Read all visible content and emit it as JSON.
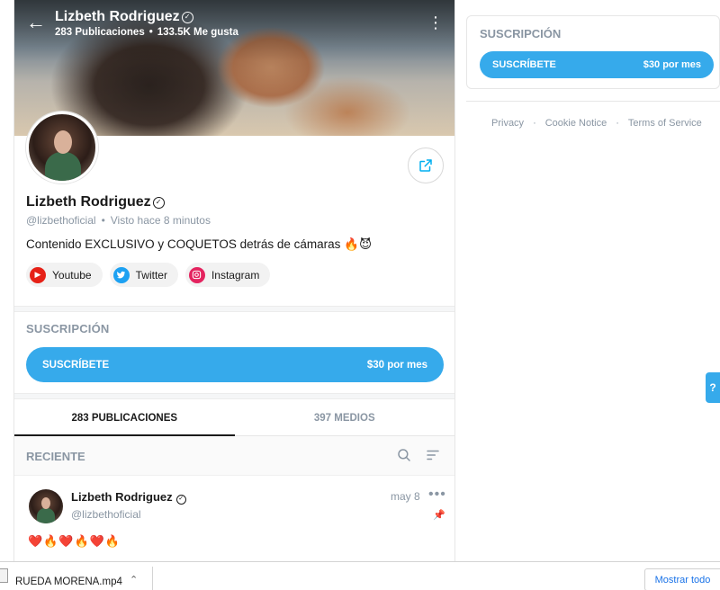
{
  "profile": {
    "name": "Lizbeth Rodriguez",
    "verified_mark": "✓",
    "posts_count": "283 Publicaciones",
    "likes_count": "133.5K Me gusta",
    "handle": "@lizbethoficial",
    "seen": "Visto  hace 8 minutos",
    "bio": "Contenido EXCLUSIVO y COQUETOS detrás de cámaras 🔥😈",
    "socials": [
      {
        "label": "Youtube",
        "icon": "youtube-icon",
        "color": "#e62117"
      },
      {
        "label": "Twitter",
        "icon": "twitter-icon",
        "color": "#1da1f2"
      },
      {
        "label": "Instagram",
        "icon": "instagram-icon",
        "color": "#e4235f"
      }
    ]
  },
  "subscription": {
    "title": "SUSCRIPCIÓN",
    "button_label": "SUSCRÍBETE",
    "price": "$30 por mes",
    "accent": "#36aaeb"
  },
  "tabs": [
    {
      "label": "283 PUBLICACIONES",
      "active": true
    },
    {
      "label": "397 MEDIOS",
      "active": false
    }
  ],
  "feed": {
    "section_label": "RECIENTE",
    "post": {
      "author": "Lizbeth Rodriguez",
      "handle": "@lizbethoficial",
      "date": "may 8",
      "more": "•••",
      "pin": "📌",
      "text": "❤️🔥❤️🔥❤️🔥"
    }
  },
  "footer_links": [
    "Privacy",
    "Cookie Notice",
    "Terms of Service"
  ],
  "help_glyph": "?",
  "download_bar": {
    "file_name": "RUEDA MORENA.mp4",
    "chevron": "⌃",
    "show_all": "Mostrar todo"
  }
}
